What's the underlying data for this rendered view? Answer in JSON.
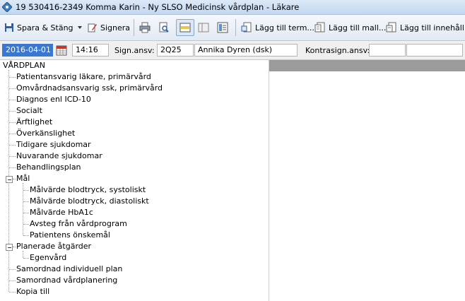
{
  "window": {
    "title": "19 530416-2349 Komma Karin - Ny SLSO Medicinsk vårdplan - Läkare"
  },
  "toolbar": {
    "save_close_label": "Spara & Stäng",
    "sign_label": "Signera",
    "add_term_label": "Lägg till term...",
    "add_template_label": "Lägg till mall...",
    "add_content_label": "Lägg till innehåll..."
  },
  "fields": {
    "date": "2016-04-01",
    "time": "14:16",
    "sign_label": "Sign.ansv:",
    "sign_code": "2Q25",
    "sign_name": "Annika Dyren (dsk)",
    "countersign_label": "Kontrasign.ansv:",
    "countersign_value": ""
  },
  "tree": {
    "root": "VÅRDPLAN",
    "items": [
      "Patientansvarig läkare, primärvård",
      "Omvårdnadsansvarig ssk, primärvård",
      "Diagnos enl ICD-10",
      "Socialt",
      "Ärftlighet",
      "Överkänslighet",
      "Tidigare sjukdomar",
      "Nuvarande sjukdomar",
      "Behandlingsplan",
      "Mål",
      "Målvärde blodtryck, systoliskt",
      "Målvärde blodtryck, diastoliskt",
      "Målvärde HbA1c",
      "Avsteg från vårdprogram",
      "Patientens önskemål",
      "Planerade åtgärder",
      "Egenvård",
      "Samordnad individuell plan",
      "Samordnad vårdplanering",
      "Kopia till"
    ]
  },
  "colors": {
    "selection": "#3a77d0",
    "panel_header": "#9b9b9b"
  }
}
